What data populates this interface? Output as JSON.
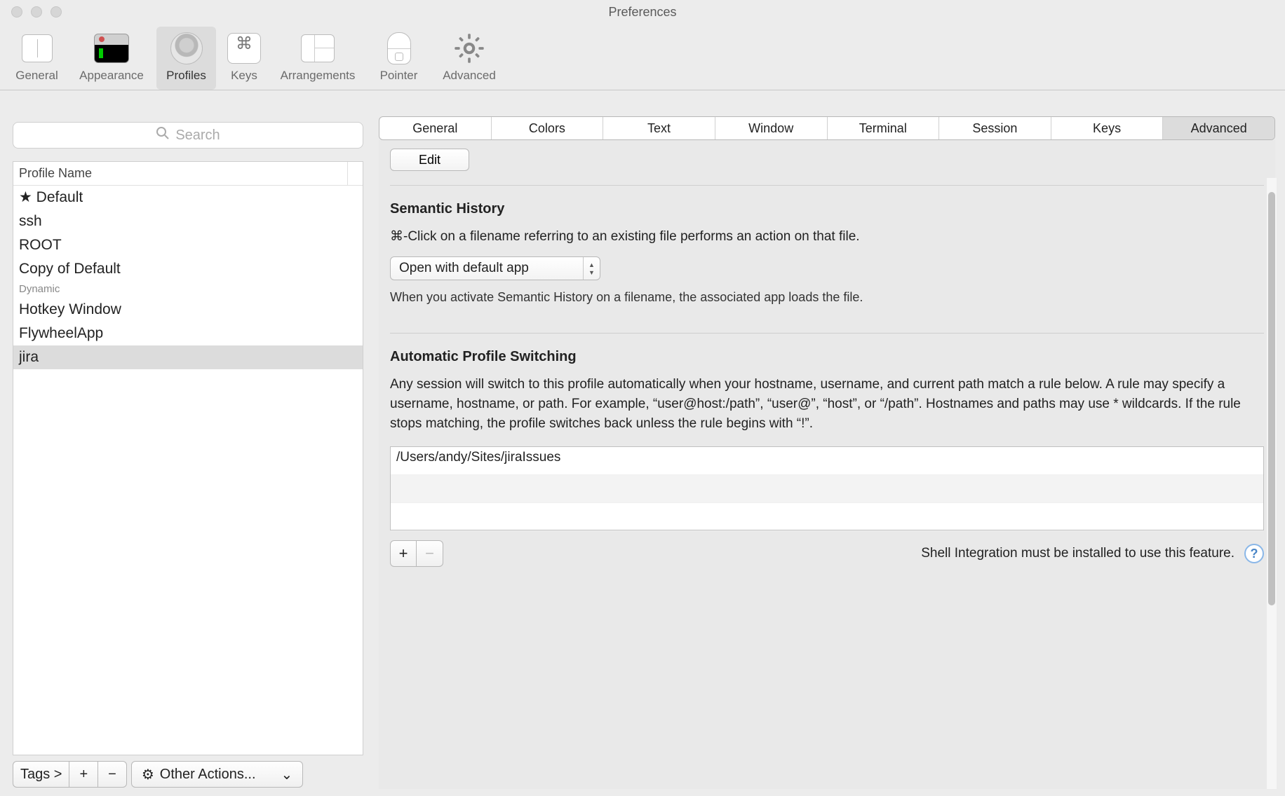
{
  "window": {
    "title": "Preferences"
  },
  "toolbar": {
    "items": [
      {
        "label": "General"
      },
      {
        "label": "Appearance"
      },
      {
        "label": "Profiles"
      },
      {
        "label": "Keys"
      },
      {
        "label": "Arrangements"
      },
      {
        "label": "Pointer"
      },
      {
        "label": "Advanced"
      }
    ],
    "active": "Profiles"
  },
  "sidebar": {
    "search_placeholder": "Search",
    "header": "Profile Name",
    "profiles": [
      {
        "label": "★ Default"
      },
      {
        "label": "ssh"
      },
      {
        "label": "ROOT"
      },
      {
        "label": "Copy of Default"
      },
      {
        "label": "Dynamic",
        "small": true
      },
      {
        "label": "Hotkey Window"
      },
      {
        "label": "FlywheelApp"
      },
      {
        "label": "jira",
        "selected": true
      }
    ],
    "tags_label": "Tags >",
    "plus": "+",
    "minus": "−",
    "other_actions": "Other Actions..."
  },
  "tabs": [
    {
      "label": "General"
    },
    {
      "label": "Colors"
    },
    {
      "label": "Text"
    },
    {
      "label": "Window"
    },
    {
      "label": "Terminal"
    },
    {
      "label": "Session"
    },
    {
      "label": "Keys"
    },
    {
      "label": "Advanced",
      "active": true
    }
  ],
  "edit_button": "Edit",
  "semantic_history": {
    "title": "Semantic History",
    "desc": "⌘-Click on a filename referring to an existing file performs an action on that file.",
    "select": "Open with default app",
    "hint": "When you activate Semantic History on a filename, the associated app loads the file."
  },
  "auto_switching": {
    "title": "Automatic Profile Switching",
    "desc": "Any session will switch to this profile automatically when your hostname, username, and current path match a rule below. A rule may specify a username, hostname, or path. For example, “user@host:/path”, “user@”, “host”, or “/path”. Hostnames and paths may use * wildcards. If the rule stops matching, the profile switches back unless the rule begins with “!”.",
    "rules": [
      "/Users/andy/Sites/jiraIssues"
    ],
    "footer": "Shell Integration must be installed to use this feature.",
    "plus": "+",
    "minus": "−",
    "help": "?"
  }
}
